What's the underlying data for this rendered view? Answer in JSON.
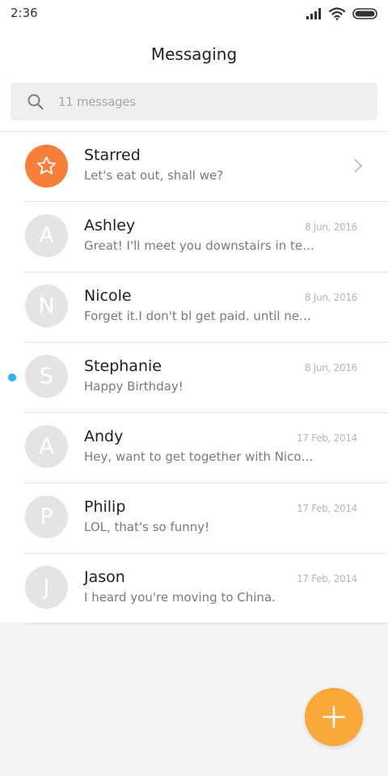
{
  "status_bar": {
    "time": "2:36",
    "icons": [
      "signal-icon",
      "wifi-icon",
      "battery-icon"
    ]
  },
  "header": {
    "title": "Messaging"
  },
  "search": {
    "icon": "search-icon",
    "placeholder": "11 messages"
  },
  "starred": {
    "title": "Starred",
    "preview": "Let's eat out, shall we?",
    "icon": "star-icon",
    "color": "#f77f3a"
  },
  "conversations": [
    {
      "initial": "A",
      "name": "Ashley",
      "date": "8 Jun, 2016",
      "preview": "Great! I'll meet you downstairs in ten minutes",
      "unread": false
    },
    {
      "initial": "N",
      "name": "Nicole",
      "date": "8 Jun, 2016",
      "preview": "Forget it.I don't bl get paid. until next Friday",
      "unread": false
    },
    {
      "initial": "S",
      "name": "Stephanie",
      "date": "8 Jun, 2016",
      "preview": "Happy Birthday!",
      "unread": true
    },
    {
      "initial": "A",
      "name": "Andy",
      "date": "17 Feb, 2014",
      "preview": "Hey, want to get together with Nicole on Friday?",
      "unread": false
    },
    {
      "initial": "P",
      "name": "Philip",
      "date": "17 Feb, 2014",
      "preview": "LOL, that's so funny!",
      "unread": false
    },
    {
      "initial": "J",
      "name": "Jason",
      "date": "17 Feb, 2014",
      "preview": "I heard you're moving to China.",
      "unread": false
    }
  ],
  "fab": {
    "icon": "plus-icon",
    "color": "#f9a83a"
  },
  "colors": {
    "unread_dot": "#2db1f0",
    "avatar_bg": "#e4e4e4"
  }
}
